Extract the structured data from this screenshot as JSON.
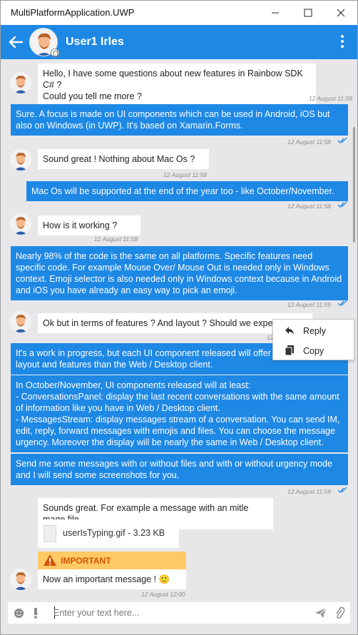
{
  "window": {
    "title": "MultiPlatformApplication.UWP"
  },
  "header": {
    "contact_name": "User1 Irles"
  },
  "messages": [
    {
      "text": "Hello, I have some questions about new features in Rainbow SDK C# ?\nCould you tell me more ?",
      "time": "12 August 11:58"
    },
    {
      "text": "Sure. A focus is made on UI components which can be used in Android, iOS but also on Windows (in UWP). It's based on Xamarin.Forms.",
      "time": "12 August 11:58"
    },
    {
      "text": "Sound great ! Nothing about Mac Os ?",
      "time": "12 August 11:58"
    },
    {
      "text": "Mac Os will be supported at the end of the year too - like October/November.",
      "time": "12 August 11:58"
    },
    {
      "text": "How is it working ?",
      "time": "12 August 11:58"
    },
    {
      "text": "Nearly 98% of the code is the same on all platforms. Specific features need specific code. For example Mouse Over/ Mouse Out is needed only in Windows context. Emoji selector is also needed only in Windows context because in Android and iOS you have already an easy way to pick an emoji.",
      "time": "12 August 11:59"
    },
    {
      "text": "Ok but in terms of features ? And layout ? Should we expect l",
      "time": "12"
    },
    {
      "text": "It's a work in progress, but each UI component released will offer ne\nlayout and features than the Web / Desktop client."
    },
    {
      "text": "In October/November, UI components released will at least:\n- ConversationsPanel: display the last recent conversations with the same amount of information like you have in Web / Desktop client.\n- MessagesStream: display messages stream of a conversation. You can send IM, edit, reply, forward messages with emojis and files. You can choose the message urgency. Moreover the display will be nearly the same in Web / Desktop client."
    },
    {
      "text": "Send me some messages with or without files and with or without urgency mode and I will send some screenshots for you.",
      "time": "12 August 11:59"
    },
    {
      "text": "Sounds great. For example a message with an mitle mage file"
    },
    {
      "file_name": "userIsTyping.gif - 3.23 KB"
    },
    {
      "urgency_label": "IMPORTANT",
      "text": "Now an important message ! 🙂",
      "time": "12 August 12:00"
    }
  ],
  "context_menu": {
    "reply": "Reply",
    "copy": "Copy"
  },
  "input": {
    "placeholder": "Enter your text here..."
  },
  "colors": {
    "accent": "#1e88e5",
    "urgency": "#ffc966",
    "urgency_text": "#d35400"
  }
}
